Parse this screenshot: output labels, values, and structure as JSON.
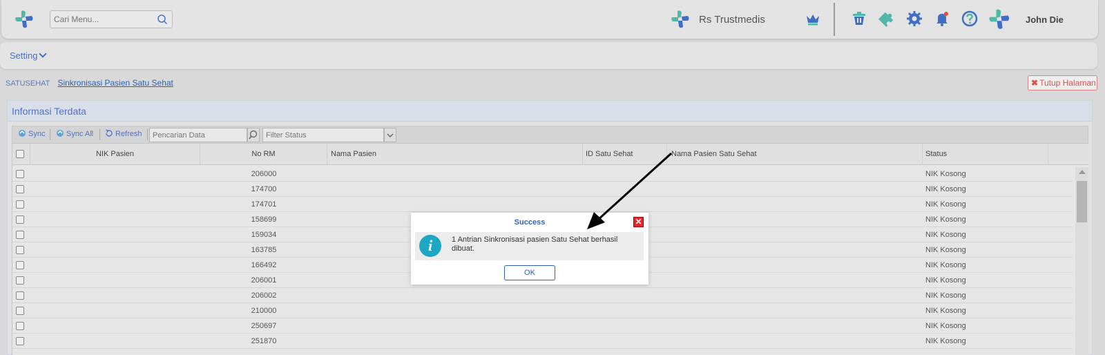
{
  "topbar": {
    "search_placeholder": "Cari Menu...",
    "hospital_name": "Rs Trustmedis",
    "user_name": "John Die",
    "icons": [
      "plus-logo-icon",
      "search-icon",
      "crown-icon",
      "basket-icon",
      "puzzle-icon",
      "gear-icon",
      "bell-icon",
      "help-icon"
    ],
    "brand_colors": {
      "teal": "#4fb8a6",
      "blue": "#3e6fc4",
      "notification": "#e74c3c"
    }
  },
  "menubar": {
    "setting_label": "Setting"
  },
  "breadcrumb": {
    "root": "SATUSEHAT",
    "current": "Sinkronisasi Pasien Satu Sehat"
  },
  "close_page_label": "Tutup Halaman",
  "panel": {
    "title": "Informasi Terdata",
    "toolbar": {
      "sync": "Sync",
      "sync_all": "Sync All",
      "refresh": "Refresh",
      "search_placeholder": "Pencarian Data",
      "status_placeholder": "Filter Status"
    },
    "columns": [
      "NIK Pasien",
      "No RM",
      "Nama Pasien",
      "ID Satu Sehat",
      "Nama Pasien Satu Sehat",
      "Status"
    ],
    "rows": [
      {
        "nik": "",
        "no_rm": "206000",
        "nama": "",
        "id_ss": "",
        "nama_ss": "",
        "status": "NIK Kosong"
      },
      {
        "nik": "",
        "no_rm": "174700",
        "nama": "",
        "id_ss": "",
        "nama_ss": "",
        "status": "NIK Kosong"
      },
      {
        "nik": "",
        "no_rm": "174701",
        "nama": "",
        "id_ss": "",
        "nama_ss": "",
        "status": "NIK Kosong"
      },
      {
        "nik": "",
        "no_rm": "158699",
        "nama": "",
        "id_ss": "",
        "nama_ss": "",
        "status": "NIK Kosong"
      },
      {
        "nik": "",
        "no_rm": "159034",
        "nama": "",
        "id_ss": "",
        "nama_ss": "",
        "status": "NIK Kosong"
      },
      {
        "nik": "",
        "no_rm": "163785",
        "nama": "",
        "id_ss": "",
        "nama_ss": "",
        "status": "NIK Kosong"
      },
      {
        "nik": "",
        "no_rm": "166492",
        "nama": "",
        "id_ss": "",
        "nama_ss": "",
        "status": "NIK Kosong"
      },
      {
        "nik": "",
        "no_rm": "206001",
        "nama": "",
        "id_ss": "",
        "nama_ss": "",
        "status": "NIK Kosong"
      },
      {
        "nik": "",
        "no_rm": "206002",
        "nama": "",
        "id_ss": "",
        "nama_ss": "",
        "status": "NIK Kosong"
      },
      {
        "nik": "",
        "no_rm": "210000",
        "nama": "",
        "id_ss": "",
        "nama_ss": "",
        "status": "NIK Kosong"
      },
      {
        "nik": "",
        "no_rm": "250697",
        "nama": "",
        "id_ss": "",
        "nama_ss": "",
        "status": "NIK Kosong"
      },
      {
        "nik": "",
        "no_rm": "251870",
        "nama": "",
        "id_ss": "",
        "nama_ss": "",
        "status": "NIK Kosong"
      }
    ]
  },
  "modal": {
    "title": "Success",
    "message": "1 Antrian Sinkronisasi pasien Satu Sehat berhasil dibuat.",
    "ok_label": "OK",
    "close_glyph": "✕",
    "info_glyph": "i"
  }
}
